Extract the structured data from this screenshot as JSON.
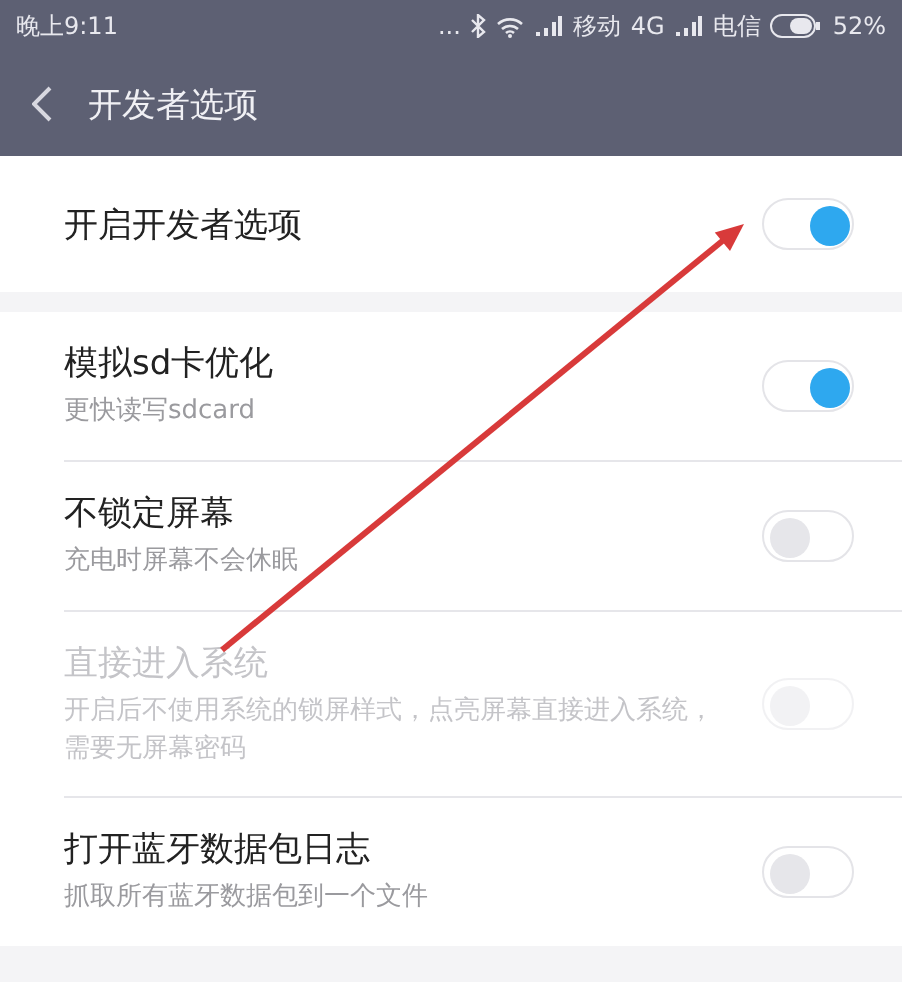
{
  "status_bar": {
    "time": "晚上9:11",
    "more": "...",
    "carrier_1": "移动",
    "network": "4G",
    "carrier_2": "电信",
    "battery": "52%"
  },
  "header": {
    "title": "开发者选项"
  },
  "groups": [
    {
      "items": [
        {
          "title": "开启开发者选项",
          "on": true,
          "disabled": false
        }
      ]
    },
    {
      "items": [
        {
          "title": "模拟sd卡优化",
          "subtitle": "更快读写sdcard",
          "on": true,
          "disabled": false
        },
        {
          "title": "不锁定屏幕",
          "subtitle": "充电时屏幕不会休眠",
          "on": false,
          "disabled": false
        },
        {
          "title": "直接进入系统",
          "subtitle": "开启后不使用系统的锁屏样式，点亮屏幕直接进入系统，需要无屏幕密码",
          "on": false,
          "disabled": true
        },
        {
          "title": "打开蓝牙数据包日志",
          "subtitle": "抓取所有蓝牙数据包到一个文件",
          "on": false,
          "disabled": false
        }
      ]
    }
  ]
}
